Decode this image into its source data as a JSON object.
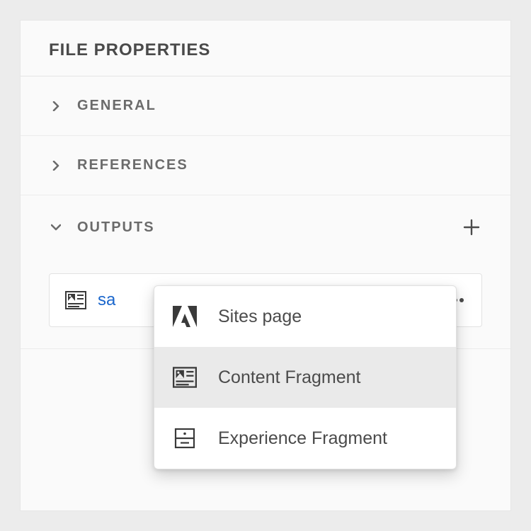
{
  "panel": {
    "title": "FILE PROPERTIES"
  },
  "sections": {
    "general": {
      "label": "GENERAL",
      "expanded": false
    },
    "references": {
      "label": "REFERENCES",
      "expanded": false
    },
    "outputs": {
      "label": "OUTPUTS",
      "expanded": true
    }
  },
  "outputs": {
    "items": [
      {
        "name": "sa",
        "icon": "content-fragment-icon"
      }
    ]
  },
  "add_menu": {
    "items": [
      {
        "label": "Sites page",
        "icon": "adobe-icon",
        "selected": false
      },
      {
        "label": "Content Fragment",
        "icon": "content-fragment-icon",
        "selected": true
      },
      {
        "label": "Experience Fragment",
        "icon": "experience-fragment-icon",
        "selected": false
      }
    ]
  },
  "colors": {
    "link": "#1a66cc",
    "text": "#4b4b4b",
    "muted": "#6b6b6b"
  }
}
